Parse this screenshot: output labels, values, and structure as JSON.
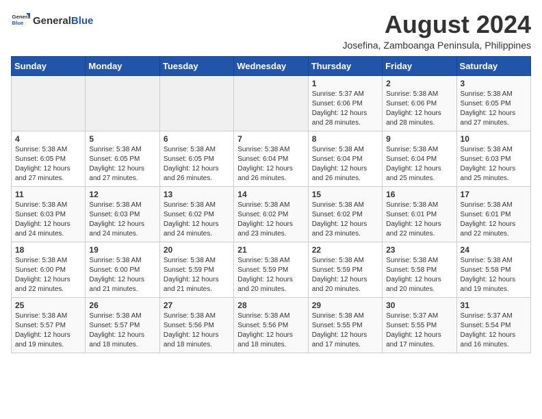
{
  "header": {
    "logo_general": "General",
    "logo_blue": "Blue",
    "main_title": "August 2024",
    "subtitle": "Josefina, Zamboanga Peninsula, Philippines"
  },
  "weekdays": [
    "Sunday",
    "Monday",
    "Tuesday",
    "Wednesday",
    "Thursday",
    "Friday",
    "Saturday"
  ],
  "weeks": [
    [
      {
        "day": "",
        "sunrise": "",
        "sunset": "",
        "daylight": ""
      },
      {
        "day": "",
        "sunrise": "",
        "sunset": "",
        "daylight": ""
      },
      {
        "day": "",
        "sunrise": "",
        "sunset": "",
        "daylight": ""
      },
      {
        "day": "",
        "sunrise": "",
        "sunset": "",
        "daylight": ""
      },
      {
        "day": "1",
        "sunrise": "Sunrise: 5:37 AM",
        "sunset": "Sunset: 6:06 PM",
        "daylight": "Daylight: 12 hours and 28 minutes."
      },
      {
        "day": "2",
        "sunrise": "Sunrise: 5:38 AM",
        "sunset": "Sunset: 6:06 PM",
        "daylight": "Daylight: 12 hours and 28 minutes."
      },
      {
        "day": "3",
        "sunrise": "Sunrise: 5:38 AM",
        "sunset": "Sunset: 6:05 PM",
        "daylight": "Daylight: 12 hours and 27 minutes."
      }
    ],
    [
      {
        "day": "4",
        "sunrise": "Sunrise: 5:38 AM",
        "sunset": "Sunset: 6:05 PM",
        "daylight": "Daylight: 12 hours and 27 minutes."
      },
      {
        "day": "5",
        "sunrise": "Sunrise: 5:38 AM",
        "sunset": "Sunset: 6:05 PM",
        "daylight": "Daylight: 12 hours and 27 minutes."
      },
      {
        "day": "6",
        "sunrise": "Sunrise: 5:38 AM",
        "sunset": "Sunset: 6:05 PM",
        "daylight": "Daylight: 12 hours and 26 minutes."
      },
      {
        "day": "7",
        "sunrise": "Sunrise: 5:38 AM",
        "sunset": "Sunset: 6:04 PM",
        "daylight": "Daylight: 12 hours and 26 minutes."
      },
      {
        "day": "8",
        "sunrise": "Sunrise: 5:38 AM",
        "sunset": "Sunset: 6:04 PM",
        "daylight": "Daylight: 12 hours and 26 minutes."
      },
      {
        "day": "9",
        "sunrise": "Sunrise: 5:38 AM",
        "sunset": "Sunset: 6:04 PM",
        "daylight": "Daylight: 12 hours and 25 minutes."
      },
      {
        "day": "10",
        "sunrise": "Sunrise: 5:38 AM",
        "sunset": "Sunset: 6:03 PM",
        "daylight": "Daylight: 12 hours and 25 minutes."
      }
    ],
    [
      {
        "day": "11",
        "sunrise": "Sunrise: 5:38 AM",
        "sunset": "Sunset: 6:03 PM",
        "daylight": "Daylight: 12 hours and 24 minutes."
      },
      {
        "day": "12",
        "sunrise": "Sunrise: 5:38 AM",
        "sunset": "Sunset: 6:03 PM",
        "daylight": "Daylight: 12 hours and 24 minutes."
      },
      {
        "day": "13",
        "sunrise": "Sunrise: 5:38 AM",
        "sunset": "Sunset: 6:02 PM",
        "daylight": "Daylight: 12 hours and 24 minutes."
      },
      {
        "day": "14",
        "sunrise": "Sunrise: 5:38 AM",
        "sunset": "Sunset: 6:02 PM",
        "daylight": "Daylight: 12 hours and 23 minutes."
      },
      {
        "day": "15",
        "sunrise": "Sunrise: 5:38 AM",
        "sunset": "Sunset: 6:02 PM",
        "daylight": "Daylight: 12 hours and 23 minutes."
      },
      {
        "day": "16",
        "sunrise": "Sunrise: 5:38 AM",
        "sunset": "Sunset: 6:01 PM",
        "daylight": "Daylight: 12 hours and 22 minutes."
      },
      {
        "day": "17",
        "sunrise": "Sunrise: 5:38 AM",
        "sunset": "Sunset: 6:01 PM",
        "daylight": "Daylight: 12 hours and 22 minutes."
      }
    ],
    [
      {
        "day": "18",
        "sunrise": "Sunrise: 5:38 AM",
        "sunset": "Sunset: 6:00 PM",
        "daylight": "Daylight: 12 hours and 22 minutes."
      },
      {
        "day": "19",
        "sunrise": "Sunrise: 5:38 AM",
        "sunset": "Sunset: 6:00 PM",
        "daylight": "Daylight: 12 hours and 21 minutes."
      },
      {
        "day": "20",
        "sunrise": "Sunrise: 5:38 AM",
        "sunset": "Sunset: 5:59 PM",
        "daylight": "Daylight: 12 hours and 21 minutes."
      },
      {
        "day": "21",
        "sunrise": "Sunrise: 5:38 AM",
        "sunset": "Sunset: 5:59 PM",
        "daylight": "Daylight: 12 hours and 20 minutes."
      },
      {
        "day": "22",
        "sunrise": "Sunrise: 5:38 AM",
        "sunset": "Sunset: 5:59 PM",
        "daylight": "Daylight: 12 hours and 20 minutes."
      },
      {
        "day": "23",
        "sunrise": "Sunrise: 5:38 AM",
        "sunset": "Sunset: 5:58 PM",
        "daylight": "Daylight: 12 hours and 20 minutes."
      },
      {
        "day": "24",
        "sunrise": "Sunrise: 5:38 AM",
        "sunset": "Sunset: 5:58 PM",
        "daylight": "Daylight: 12 hours and 19 minutes."
      }
    ],
    [
      {
        "day": "25",
        "sunrise": "Sunrise: 5:38 AM",
        "sunset": "Sunset: 5:57 PM",
        "daylight": "Daylight: 12 hours and 19 minutes."
      },
      {
        "day": "26",
        "sunrise": "Sunrise: 5:38 AM",
        "sunset": "Sunset: 5:57 PM",
        "daylight": "Daylight: 12 hours and 18 minutes."
      },
      {
        "day": "27",
        "sunrise": "Sunrise: 5:38 AM",
        "sunset": "Sunset: 5:56 PM",
        "daylight": "Daylight: 12 hours and 18 minutes."
      },
      {
        "day": "28",
        "sunrise": "Sunrise: 5:38 AM",
        "sunset": "Sunset: 5:56 PM",
        "daylight": "Daylight: 12 hours and 18 minutes."
      },
      {
        "day": "29",
        "sunrise": "Sunrise: 5:38 AM",
        "sunset": "Sunset: 5:55 PM",
        "daylight": "Daylight: 12 hours and 17 minutes."
      },
      {
        "day": "30",
        "sunrise": "Sunrise: 5:37 AM",
        "sunset": "Sunset: 5:55 PM",
        "daylight": "Daylight: 12 hours and 17 minutes."
      },
      {
        "day": "31",
        "sunrise": "Sunrise: 5:37 AM",
        "sunset": "Sunset: 5:54 PM",
        "daylight": "Daylight: 12 hours and 16 minutes."
      }
    ]
  ]
}
